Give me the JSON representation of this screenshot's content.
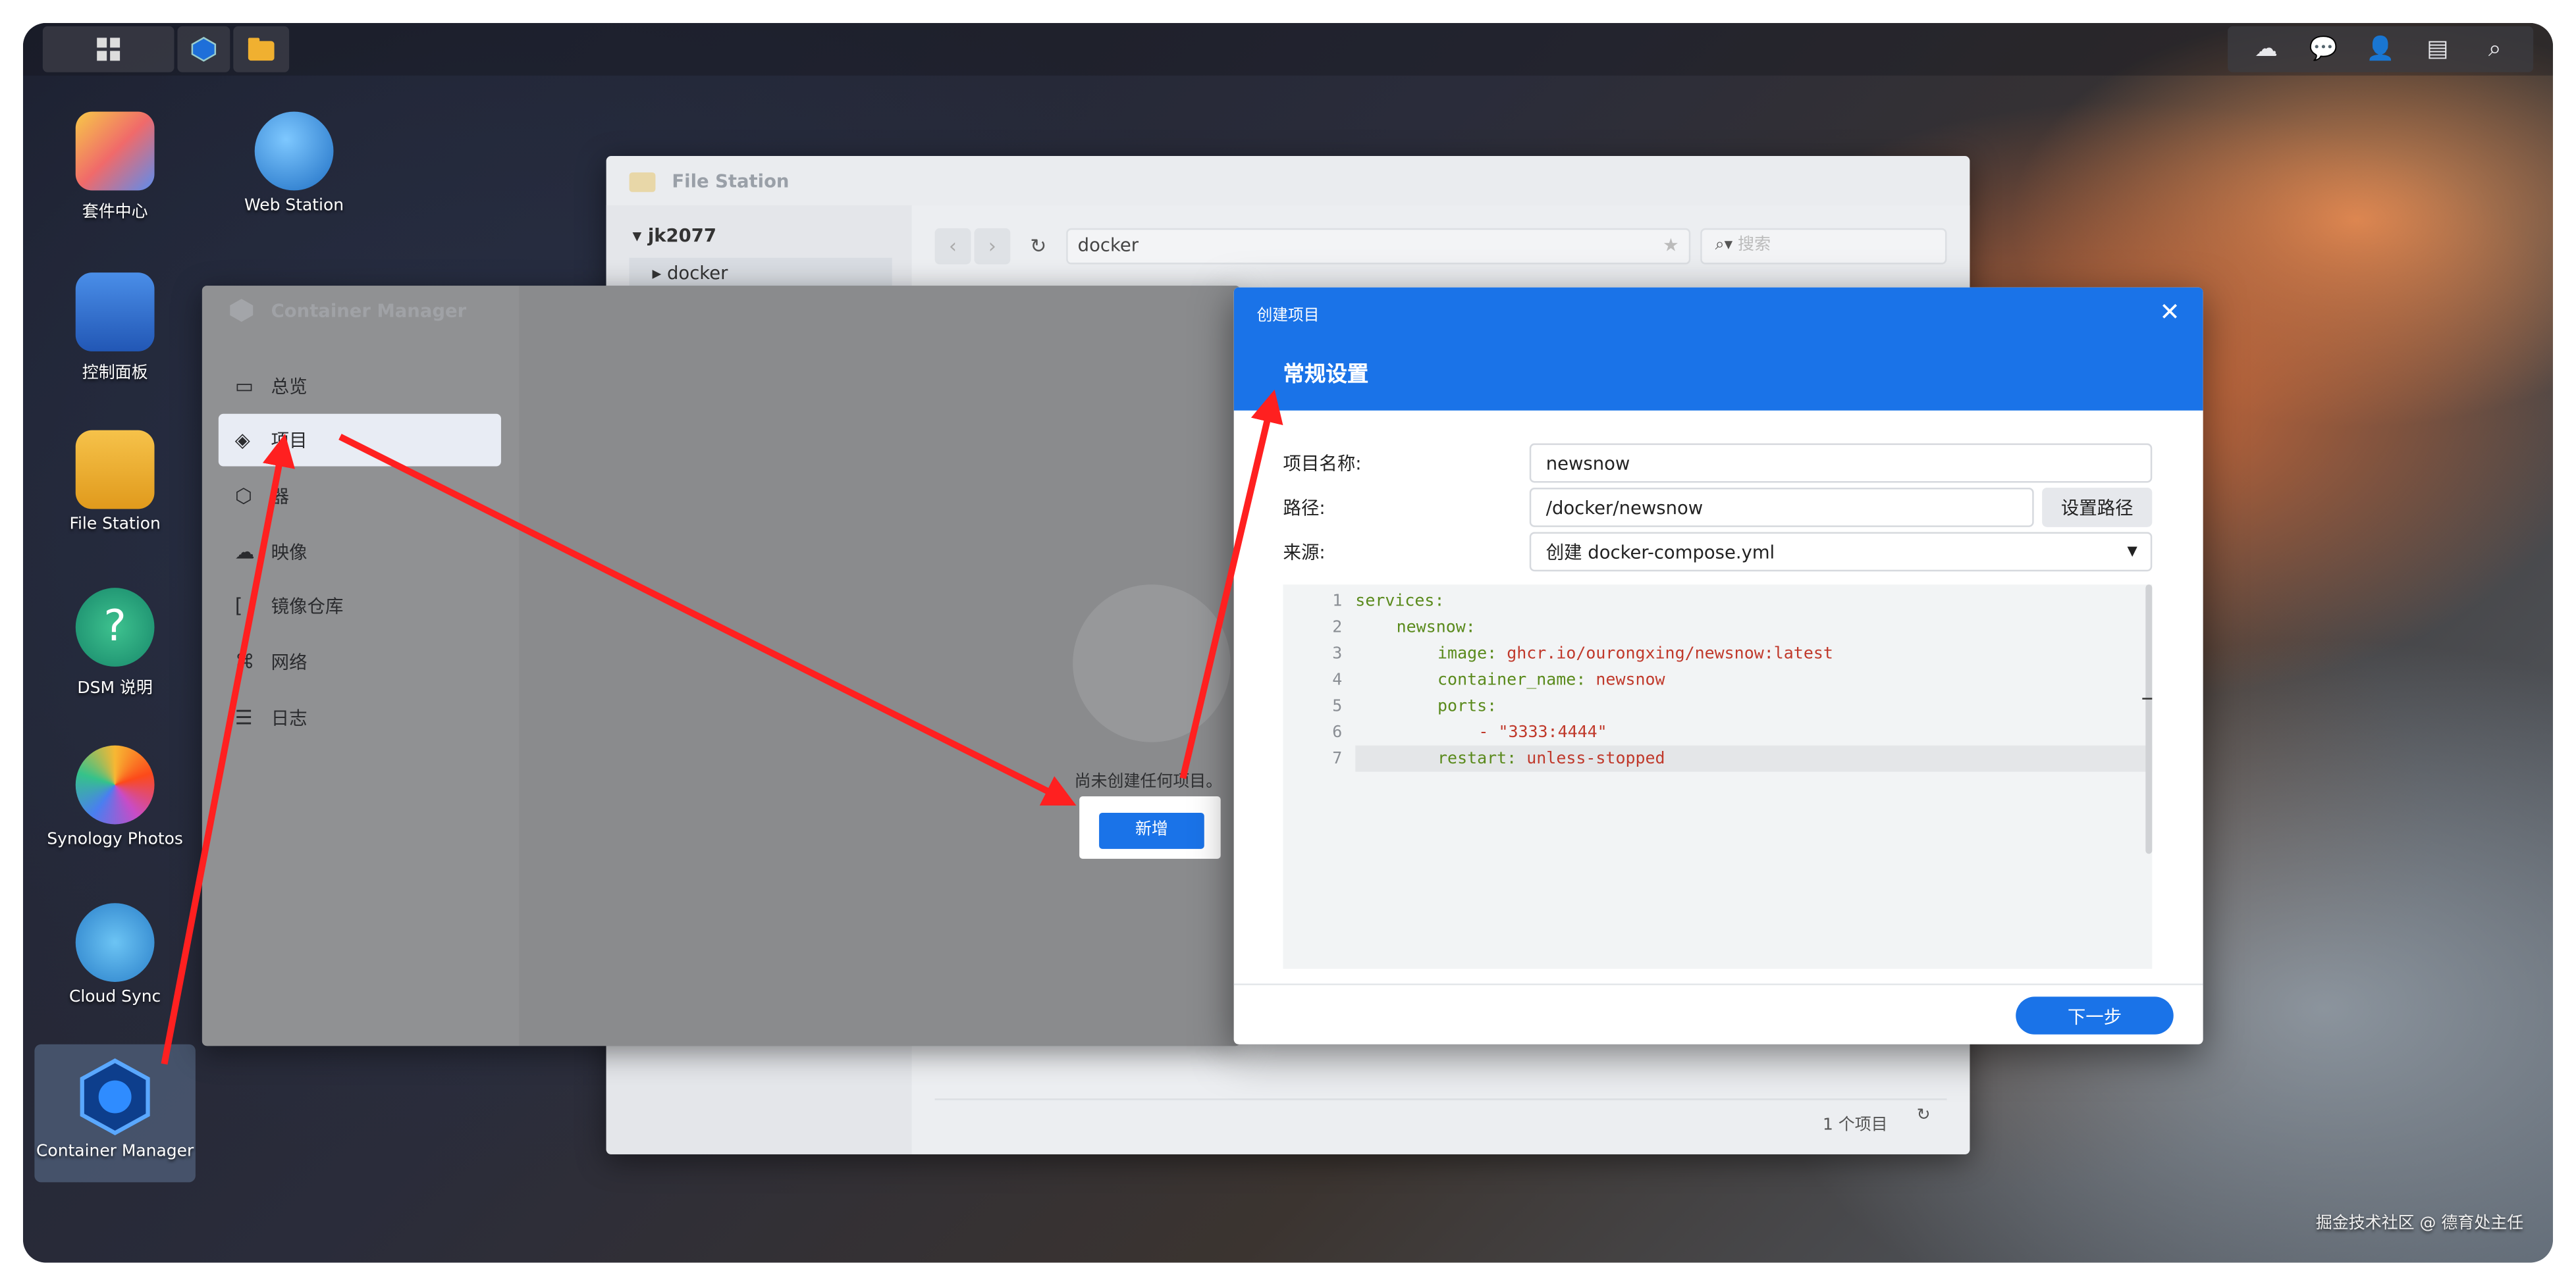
{
  "taskbar": {
    "right_icons": [
      "cloud-sync-status-icon",
      "chat-icon",
      "user-icon",
      "widgets-icon",
      "search-icon"
    ]
  },
  "desktop": {
    "icons": [
      {
        "label": "套件中心",
        "icon": "package-center-icon"
      },
      {
        "label": "Web Station",
        "icon": "web-station-icon"
      },
      {
        "label": "控制面板",
        "icon": "control-panel-icon"
      },
      {
        "label": "File Station",
        "icon": "file-station-icon"
      },
      {
        "label": "DSM 说明",
        "icon": "dsm-help-icon"
      },
      {
        "label": "Synology Photos",
        "icon": "synology-photos-icon"
      },
      {
        "label": "Cloud Sync",
        "icon": "cloud-sync-icon"
      },
      {
        "label": "Container Manager",
        "icon": "container-manager-icon"
      }
    ]
  },
  "file_station": {
    "title": "File Station",
    "tree_root": "jk2077",
    "tree_child": "docker",
    "path": "docker",
    "search_placeholder": "搜索",
    "item_count": "1 个项目"
  },
  "container_manager": {
    "title": "Container Manager",
    "nav": [
      {
        "label": "总览",
        "icon": "overview-icon"
      },
      {
        "label": "项目",
        "icon": "project-icon"
      },
      {
        "label": "器",
        "icon": "container-icon"
      },
      {
        "label": "映像",
        "icon": "image-icon"
      },
      {
        "label": "镜像仓库",
        "icon": "registry-icon"
      },
      {
        "label": "网络",
        "icon": "network-icon"
      },
      {
        "label": "日志",
        "icon": "log-icon"
      }
    ],
    "empty_text": "尚未创建任何项目。",
    "add_button": "新增"
  },
  "dialog": {
    "subtitle": "创建项目",
    "title": "常规设置",
    "fields": {
      "name_label": "项目名称:",
      "name_value": "newsnow",
      "path_label": "路径:",
      "path_value": "/docker/newsnow",
      "set_path_button": "设置路径",
      "source_label": "来源:",
      "source_value": "创建 docker-compose.yml"
    },
    "code": {
      "l1": "services:",
      "l2": "newsnow:",
      "l3k": "image:",
      "l3v": "ghcr.io/ourongxing/newsnow:latest",
      "l4k": "container_name:",
      "l4v": "newsnow",
      "l5": "ports:",
      "l6": "- \"3333:4444\"",
      "l7k": "restart:",
      "l7v": "unless-stopped"
    },
    "next_button": "下一步"
  },
  "watermark": "掘金技术社区 @ 德育处主任",
  "colors": {
    "accent": "#1a73e8",
    "annotation_arrow": "#ff2020"
  }
}
